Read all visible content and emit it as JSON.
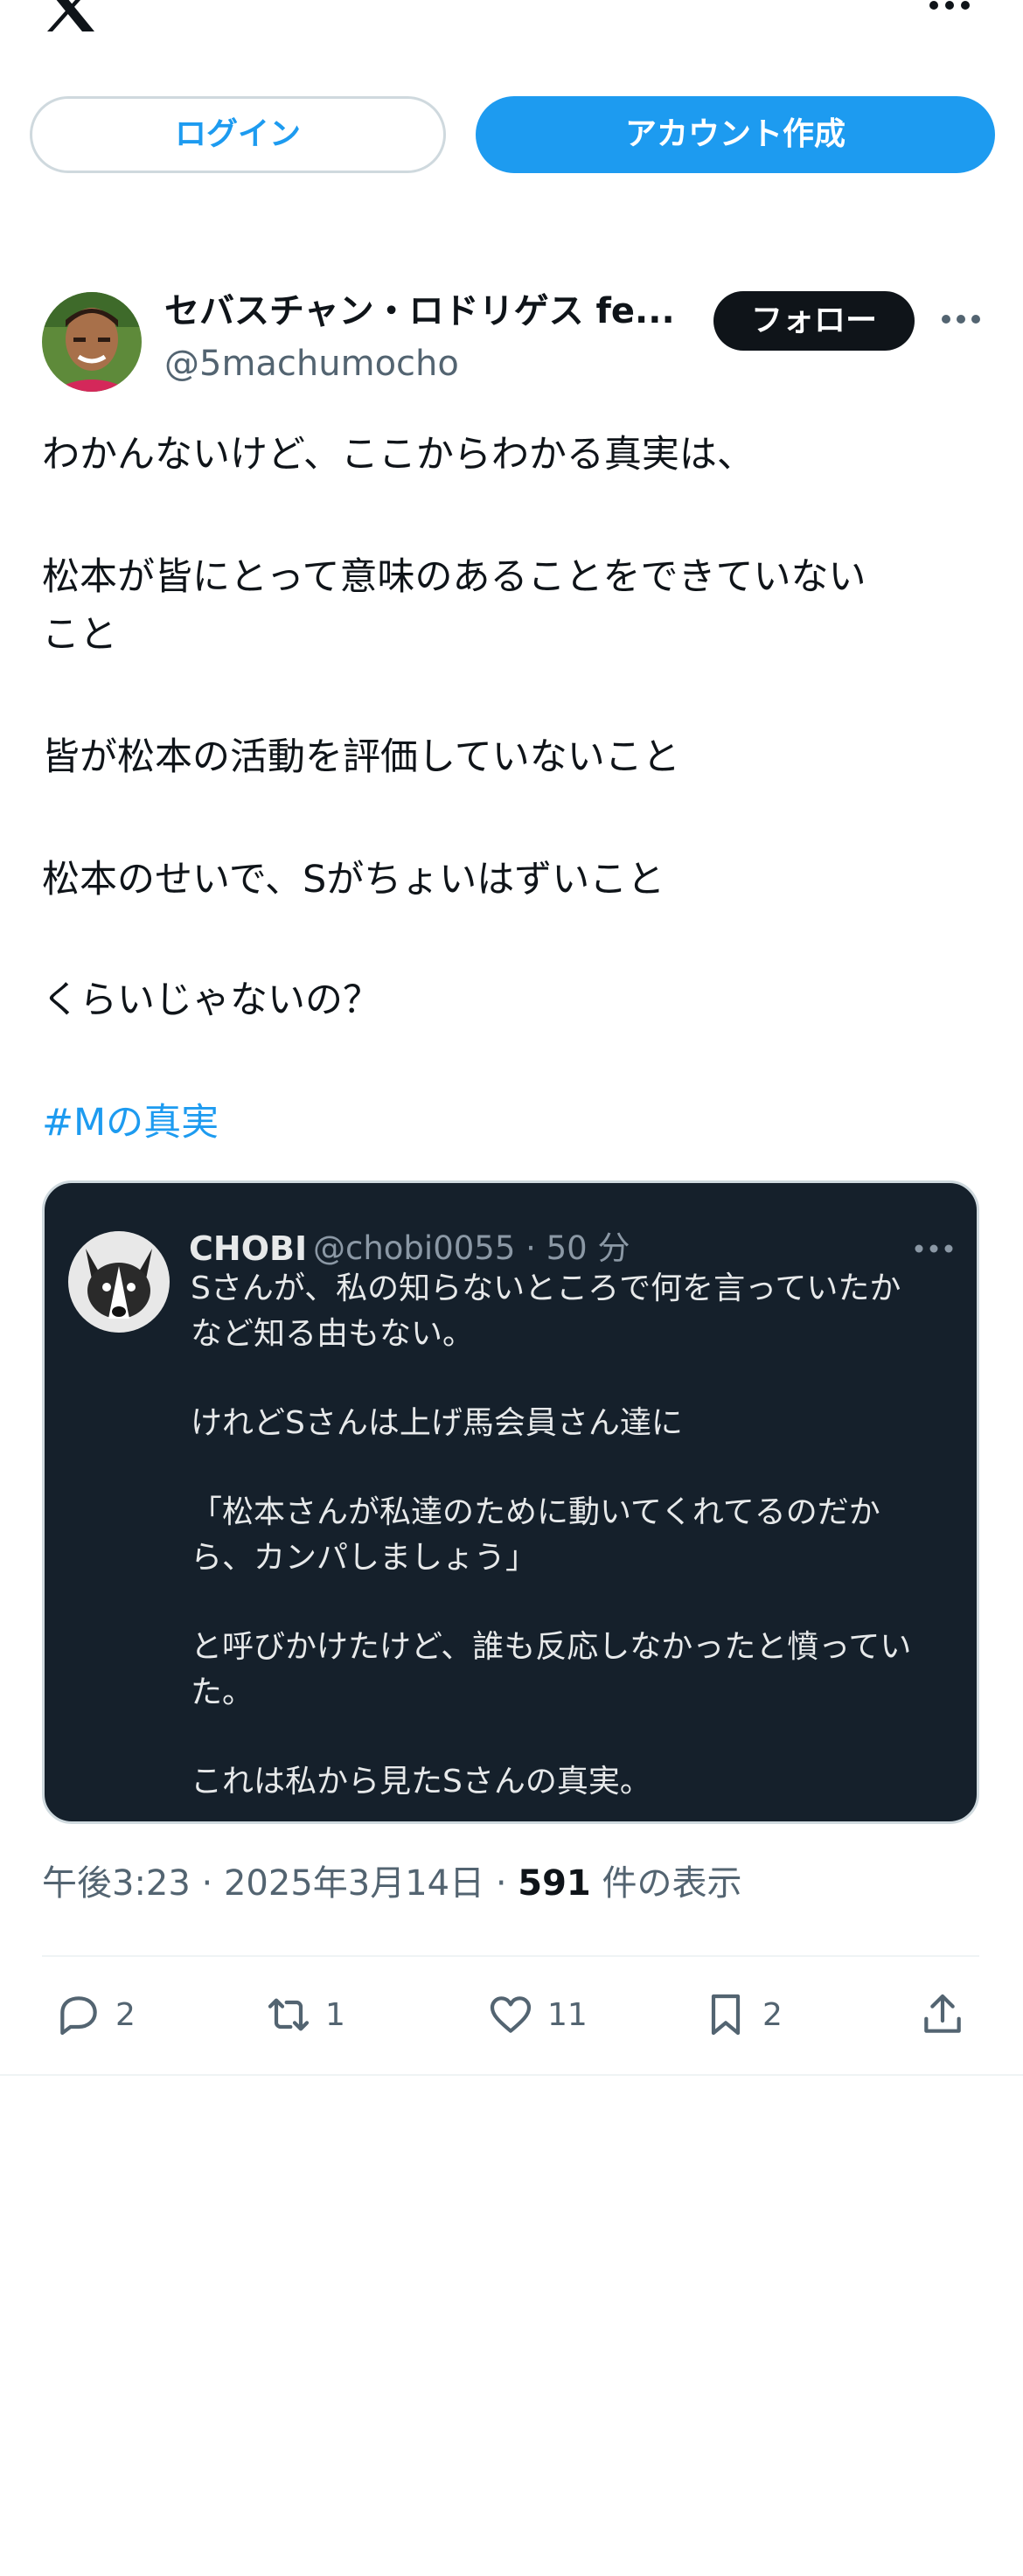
{
  "header": {
    "logo_icon": "x-logo-icon",
    "more_icon": "more-horizontal-icon"
  },
  "auth": {
    "login_label": "ログイン",
    "signup_label": "アカウント作成"
  },
  "post": {
    "author_name": "セバスチャン・ロドリゲス fe...",
    "author_handle": "@5machumocho",
    "follow_label": "フォロー",
    "lines": [
      "わかんないけど、ここからわかる真実は、",
      "松本が皆にとって意味のあることをできていない",
      "こと",
      "皆が松本の活動を評価していないこと",
      "松本のせいで、Sがちょいはずいこと",
      "くらいじゃないの？"
    ],
    "hashtag": "#Mの真実",
    "time": "午後3:23 · 2025年3月14日 · ",
    "views_count": "591",
    "views_label": " 件の表示"
  },
  "quote": {
    "name": "CHOBI",
    "handle": "@chobi0055 · 50 分",
    "lines": [
      "Sさんが、私の知らないところで何を言っていたか",
      "など知る由もない。",
      "けれどSさんは上げ馬会員さん達に",
      "「松本さんが私達のために動いてくれてるのだか",
      "ら、カンパしましょう」",
      "と呼びかけたけど、誰も反応しなかったと憤ってい",
      "た。",
      "これは私から見たSさんの真実。"
    ]
  },
  "actions": {
    "reply_count": "2",
    "repost_count": "1",
    "like_count": "11",
    "bookmark_count": "2"
  },
  "colors": {
    "accent": "#1d9bf0",
    "text": "#0f1419",
    "muted": "#536471",
    "quote_bg": "#15202b"
  }
}
